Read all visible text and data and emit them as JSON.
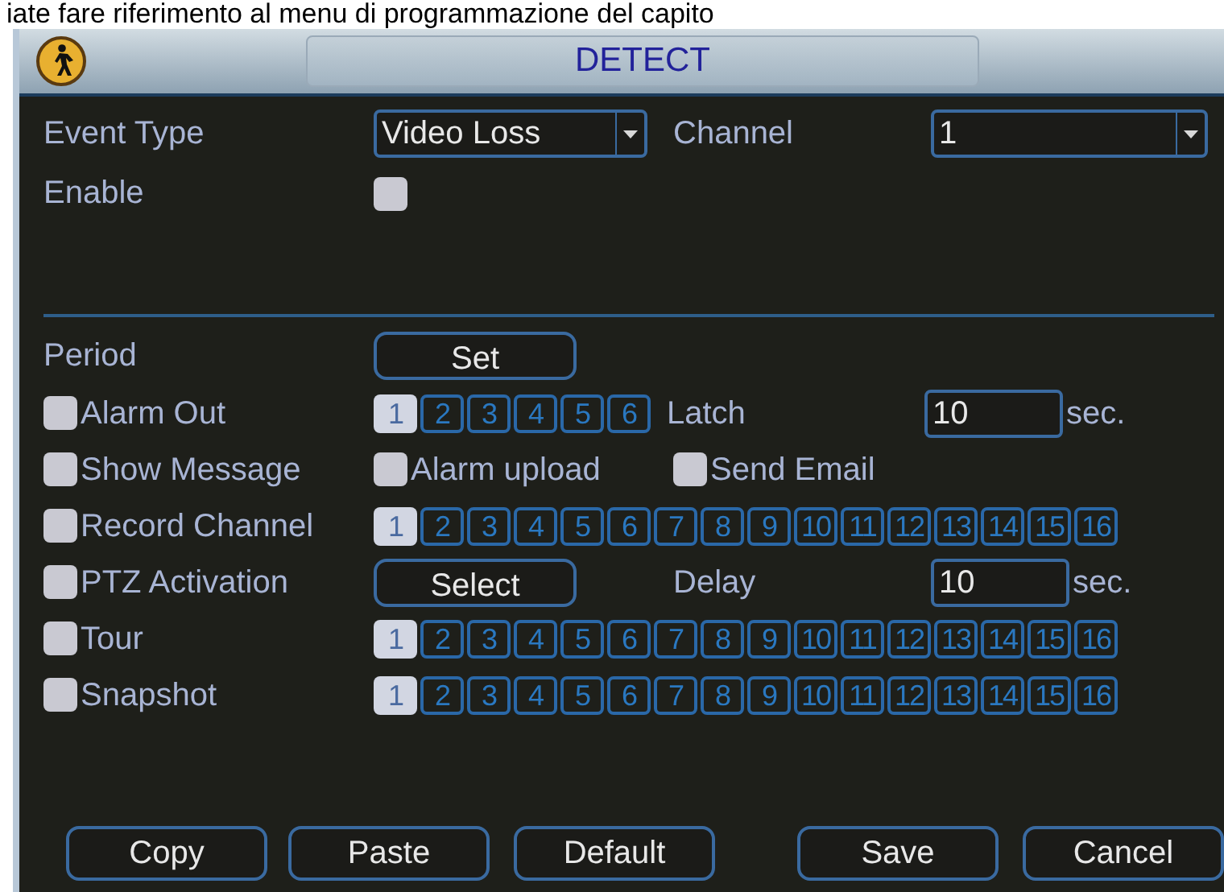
{
  "top_caption": "iate fare riferimento al menu di programmazione del capito",
  "window": {
    "title": "DETECT"
  },
  "event_type": {
    "label": "Event Type",
    "value": "Video Loss"
  },
  "channel": {
    "label": "Channel",
    "value": "1"
  },
  "enable": {
    "label": "Enable",
    "checked": false
  },
  "period": {
    "label": "Period",
    "button": "Set"
  },
  "rows": [
    {
      "kind": "channels",
      "label": "Alarm Out",
      "checked": false,
      "channels": [
        {
          "label": "1",
          "selected": true
        },
        {
          "label": "2",
          "selected": false
        },
        {
          "label": "3",
          "selected": false
        },
        {
          "label": "4",
          "selected": false
        },
        {
          "label": "5",
          "selected": false
        },
        {
          "label": "6",
          "selected": false
        }
      ],
      "field": {
        "label": "Latch",
        "value": "10",
        "unit": "sec."
      }
    },
    {
      "kind": "options",
      "label": "Show Message",
      "checked": false,
      "options": [
        {
          "label": "Alarm upload",
          "checked": false
        },
        {
          "label": "Send Email",
          "checked": false
        }
      ]
    },
    {
      "kind": "channels",
      "label": "Record Channel",
      "checked": false,
      "channels": [
        {
          "label": "1",
          "selected": true
        },
        {
          "label": "2",
          "selected": false
        },
        {
          "label": "3",
          "selected": false
        },
        {
          "label": "4",
          "selected": false
        },
        {
          "label": "5",
          "selected": false
        },
        {
          "label": "6",
          "selected": false
        },
        {
          "label": "7",
          "selected": false
        },
        {
          "label": "8",
          "selected": false
        },
        {
          "label": "9",
          "selected": false
        },
        {
          "label": "10",
          "selected": false
        },
        {
          "label": "11",
          "selected": false
        },
        {
          "label": "12",
          "selected": false
        },
        {
          "label": "13",
          "selected": false
        },
        {
          "label": "14",
          "selected": false
        },
        {
          "label": "15",
          "selected": false
        },
        {
          "label": "16",
          "selected": false
        }
      ]
    },
    {
      "kind": "button",
      "label": "PTZ Activation",
      "checked": false,
      "button": "Select",
      "field": {
        "label": "Delay",
        "value": "10",
        "unit": "sec."
      }
    },
    {
      "kind": "channels",
      "label": "Tour",
      "checked": false,
      "channels": [
        {
          "label": "1",
          "selected": true
        },
        {
          "label": "2",
          "selected": false
        },
        {
          "label": "3",
          "selected": false
        },
        {
          "label": "4",
          "selected": false
        },
        {
          "label": "5",
          "selected": false
        },
        {
          "label": "6",
          "selected": false
        },
        {
          "label": "7",
          "selected": false
        },
        {
          "label": "8",
          "selected": false
        },
        {
          "label": "9",
          "selected": false
        },
        {
          "label": "10",
          "selected": false
        },
        {
          "label": "11",
          "selected": false
        },
        {
          "label": "12",
          "selected": false
        },
        {
          "label": "13",
          "selected": false
        },
        {
          "label": "14",
          "selected": false
        },
        {
          "label": "15",
          "selected": false
        },
        {
          "label": "16",
          "selected": false
        }
      ]
    },
    {
      "kind": "channels",
      "label": "Snapshot",
      "checked": false,
      "channels": [
        {
          "label": "1",
          "selected": true
        },
        {
          "label": "2",
          "selected": false
        },
        {
          "label": "3",
          "selected": false
        },
        {
          "label": "4",
          "selected": false
        },
        {
          "label": "5",
          "selected": false
        },
        {
          "label": "6",
          "selected": false
        },
        {
          "label": "7",
          "selected": false
        },
        {
          "label": "8",
          "selected": false
        },
        {
          "label": "9",
          "selected": false
        },
        {
          "label": "10",
          "selected": false
        },
        {
          "label": "11",
          "selected": false
        },
        {
          "label": "12",
          "selected": false
        },
        {
          "label": "13",
          "selected": false
        },
        {
          "label": "14",
          "selected": false
        },
        {
          "label": "15",
          "selected": false
        },
        {
          "label": "16",
          "selected": false
        }
      ]
    }
  ],
  "buttons": [
    "Copy",
    "Paste",
    "Default",
    "Save",
    "Cancel"
  ]
}
